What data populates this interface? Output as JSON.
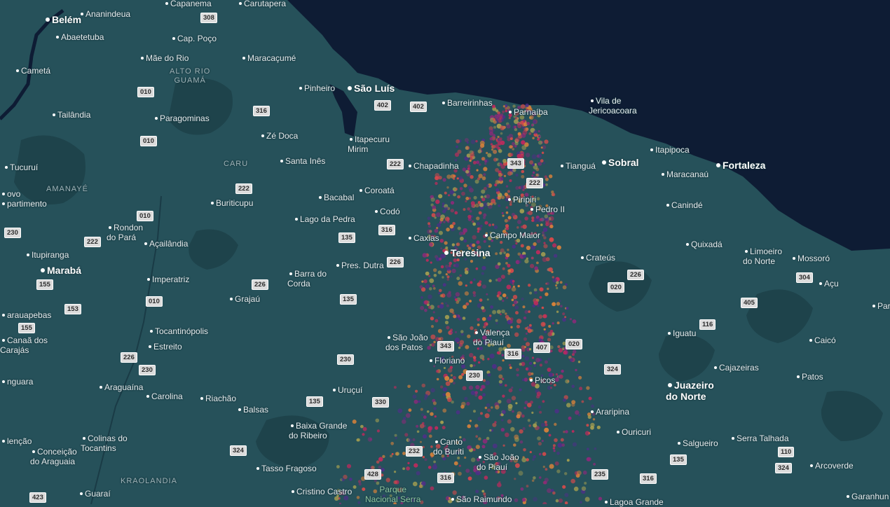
{
  "colors": {
    "land": "#26515a",
    "ocean": "#0e1c34",
    "heat": [
      "#c02a5c",
      "#8b2a7a",
      "#d9823a",
      "#a7a050",
      "#4e2f88",
      "#d94a4a"
    ]
  },
  "cities": [
    {
      "name": "Belém",
      "major": true
    },
    {
      "name": "Ananindeua"
    },
    {
      "name": "Capanema"
    },
    {
      "name": "Carutapera"
    },
    {
      "name": "Abaetetuba"
    },
    {
      "name": "Cap. Poço"
    },
    {
      "name": "Mãe do Rio"
    },
    {
      "name": "Maracaçumé"
    },
    {
      "name": "Cametá"
    },
    {
      "name": "Pinheiro"
    },
    {
      "name": "São Luís",
      "major": true
    },
    {
      "name": "Barreirinhas"
    },
    {
      "name": "Parnaíba"
    },
    {
      "name": "Vila de\nJericoacoara"
    },
    {
      "name": "Tailândia"
    },
    {
      "name": "Paragominas"
    },
    {
      "name": "Zé Doca"
    },
    {
      "name": "Itapecuru\nMirim"
    },
    {
      "name": "Itapipoca"
    },
    {
      "name": "Tucuruí"
    },
    {
      "name": "Santa Inês"
    },
    {
      "name": "Chapadinha"
    },
    {
      "name": "Tianguá"
    },
    {
      "name": "Sobral",
      "major": true
    },
    {
      "name": "Maracanaú"
    },
    {
      "name": "Fortaleza",
      "major": true
    },
    {
      "name": "ovo"
    },
    {
      "name": "Bacabal"
    },
    {
      "name": "Coroatá"
    },
    {
      "name": "Piripiri"
    },
    {
      "name": "Buriticupu"
    },
    {
      "name": "partimento"
    },
    {
      "name": "Codó"
    },
    {
      "name": "Pedro II"
    },
    {
      "name": "Canindé"
    },
    {
      "name": "Lago da Pedra"
    },
    {
      "name": "Rondon\ndo Pará"
    },
    {
      "name": "Campo Maior"
    },
    {
      "name": "Caxias"
    },
    {
      "name": "Açailândia"
    },
    {
      "name": "Quixadá"
    },
    {
      "name": "Teresina",
      "major": true
    },
    {
      "name": "Limoeiro\ndo Norte"
    },
    {
      "name": "Itupiranga"
    },
    {
      "name": "Crateús"
    },
    {
      "name": "Mossoró"
    },
    {
      "name": "Pres. Dutra"
    },
    {
      "name": "Marabá",
      "major": true
    },
    {
      "name": "Barra do\nCorda"
    },
    {
      "name": "Imperatriz"
    },
    {
      "name": "Açu"
    },
    {
      "name": "Grajaú"
    },
    {
      "name": "Par"
    },
    {
      "name": "arauapebas"
    },
    {
      "name": "Tocantinópolis"
    },
    {
      "name": "Valença\ndo Piauí"
    },
    {
      "name": "Iguatu"
    },
    {
      "name": "Canaã dos\nCarajás"
    },
    {
      "name": "São João\ndos Patos"
    },
    {
      "name": "Caicó"
    },
    {
      "name": "Estreito"
    },
    {
      "name": "Floriano"
    },
    {
      "name": "Cajazeiras"
    },
    {
      "name": "nguara"
    },
    {
      "name": "Picos"
    },
    {
      "name": "Patos"
    },
    {
      "name": "Araguaína"
    },
    {
      "name": "Uruçuí"
    },
    {
      "name": "Juazeiro\ndo Norte",
      "major": true
    },
    {
      "name": "Carolina"
    },
    {
      "name": "Riachão"
    },
    {
      "name": "Balsas"
    },
    {
      "name": "Araripina"
    },
    {
      "name": "Baixa Grande\ndo Ribeiro"
    },
    {
      "name": "Ouricuri"
    },
    {
      "name": "Serra Talhada"
    },
    {
      "name": "Colinas do\nTocantins"
    },
    {
      "name": "lenção"
    },
    {
      "name": "Canto\ndo Buriti"
    },
    {
      "name": "Salgueiro"
    },
    {
      "name": "Conceição\ndo Araguaia"
    },
    {
      "name": "São João\ndo Piauí"
    },
    {
      "name": "Arcoverde"
    },
    {
      "name": "Tasso Fragoso"
    },
    {
      "name": "Guaraí"
    },
    {
      "name": "Cristino Castro"
    },
    {
      "name": "São Raimundo"
    },
    {
      "name": "Lagoa Grande"
    },
    {
      "name": "Garanhun"
    }
  ],
  "regions": [
    "ALTO RIO\nGUAMÁ",
    "CARU",
    "AMANAYÉ",
    "KRAOLANDIA"
  ],
  "park": "Parque\nNacional Serra",
  "road_shields": [
    "308",
    "010",
    "402",
    "402",
    "316",
    "010",
    "343",
    "222",
    "222",
    "222",
    "010",
    "316",
    "230",
    "222",
    "135",
    "226",
    "155",
    "226",
    "153",
    "135",
    "010",
    "155",
    "020",
    "226",
    "405",
    "304",
    "116",
    "343",
    "316",
    "407",
    "020",
    "226",
    "230",
    "230",
    "230",
    "324",
    "135",
    "330",
    "324",
    "232",
    "316",
    "110",
    "135",
    "324",
    "428",
    "235",
    "316",
    "423"
  ]
}
